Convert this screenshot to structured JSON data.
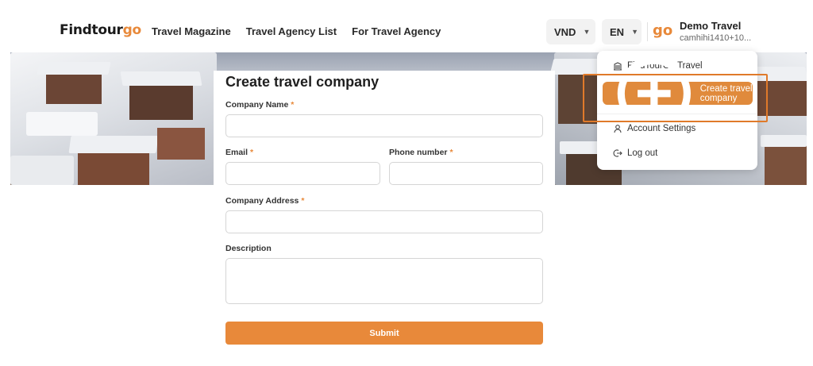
{
  "header": {
    "logo_main": "Findtour",
    "logo_accent": "go",
    "nav": [
      "Travel Magazine",
      "Travel Agency List",
      "For Travel Agency"
    ],
    "currency": "VND",
    "language": "EN",
    "avatar_text": "go",
    "user_name": "Demo Travel",
    "user_email": "camhihi1410+10..."
  },
  "form": {
    "title": "Create travel company",
    "company_name_label": "Company Name",
    "email_label": "Email",
    "phone_label": "Phone number",
    "address_label": "Company Address",
    "description_label": "Description",
    "required_mark": "*",
    "submit_label": "Submit"
  },
  "menu": {
    "items": [
      "FindTourGo Travel",
      "Create travel company",
      "Account Settings",
      "Log out"
    ]
  },
  "colors": {
    "accent": "#e8893a",
    "highlight_border": "#e07a2a"
  }
}
